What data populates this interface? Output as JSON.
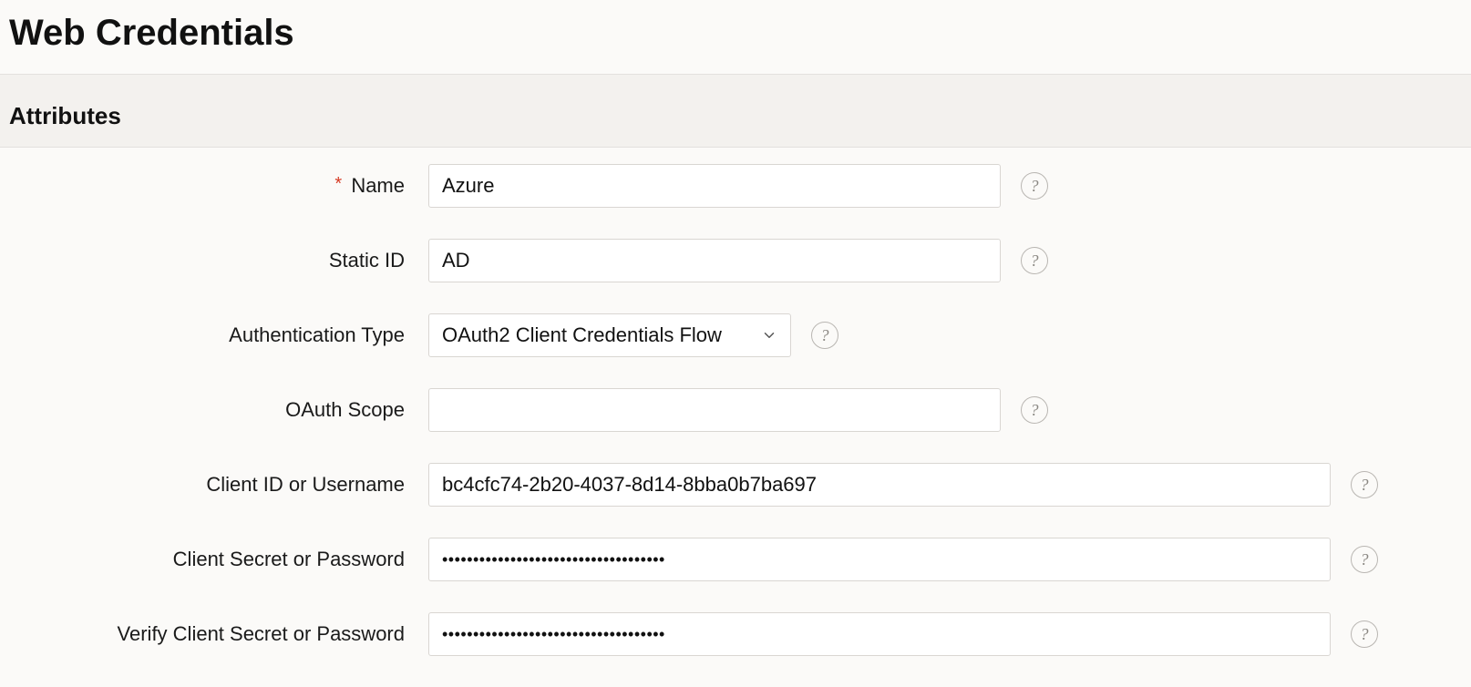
{
  "page": {
    "title": "Web Credentials"
  },
  "section": {
    "title": "Attributes"
  },
  "fields": {
    "name": {
      "label": "Name",
      "required_marker": "*",
      "value": "Azure"
    },
    "static_id": {
      "label": "Static ID",
      "value": "AD"
    },
    "auth_type": {
      "label": "Authentication Type",
      "value": "OAuth2 Client Credentials Flow"
    },
    "oauth_scope": {
      "label": "OAuth Scope",
      "value": ""
    },
    "client_id": {
      "label": "Client ID or Username",
      "value": "bc4cfc74-2b20-4037-8d14-8bba0b7ba697"
    },
    "client_secret": {
      "label": "Client Secret or Password",
      "value": "••••••••••••••••••••••••••••••••••••"
    },
    "verify_client_secret": {
      "label": "Verify Client Secret or Password",
      "value": "••••••••••••••••••••••••••••••••••••"
    }
  }
}
